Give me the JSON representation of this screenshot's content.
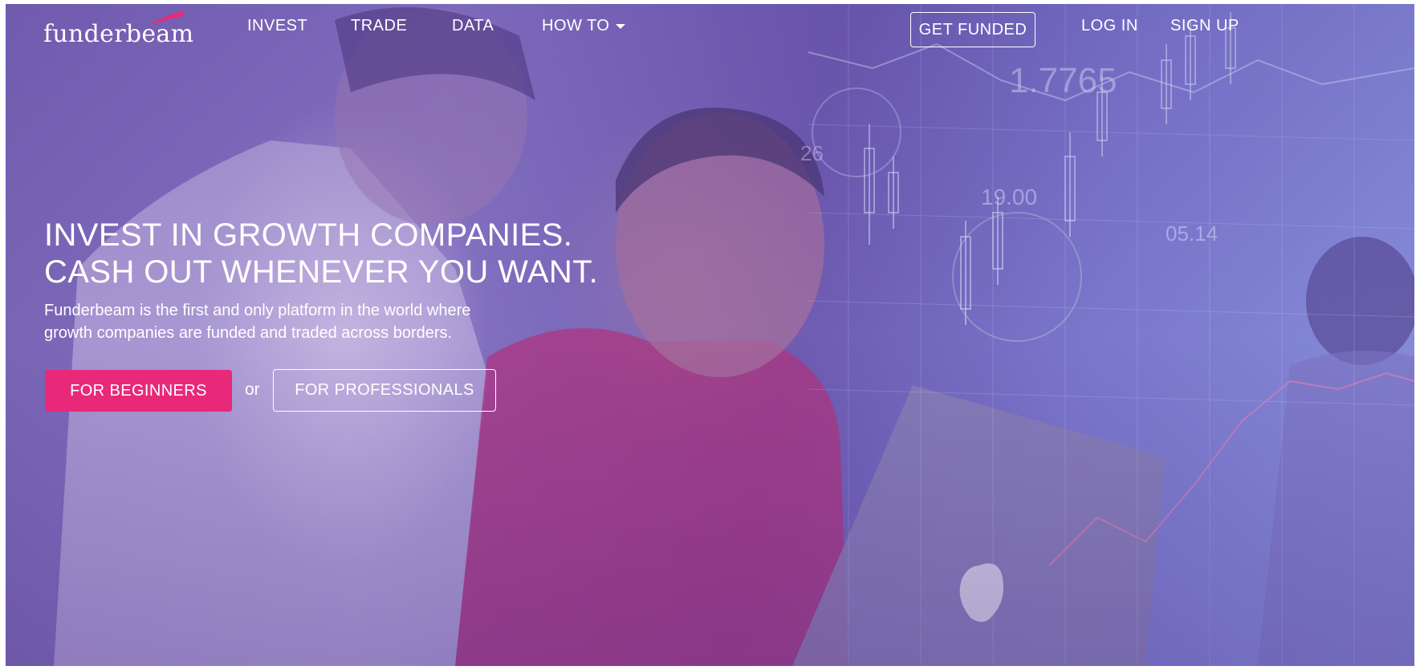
{
  "brand": {
    "name": "funderbeam",
    "accent_color": "#e8297a"
  },
  "nav": {
    "invest": "INVEST",
    "trade": "TRADE",
    "data": "DATA",
    "how_to": "HOW TO",
    "get_funded": "GET FUNDED",
    "log_in": "LOG IN",
    "sign_up": "SIGN UP"
  },
  "hero": {
    "headline_line1": "INVEST IN GROWTH COMPANIES.",
    "headline_line2": "CASH OUT WHENEVER YOU WANT.",
    "subtext_line1": "Funderbeam is the first and only platform in the world where",
    "subtext_line2": "growth companies are funded and traded across borders.",
    "cta_beginners": "FOR BEGINNERS",
    "or": "or",
    "cta_professionals": "FOR PROFESSIONALS"
  },
  "background": {
    "ticker_1": "1.7765",
    "ticker_2": "19.00",
    "ticker_3": "05.14",
    "ticker_4": "26"
  }
}
